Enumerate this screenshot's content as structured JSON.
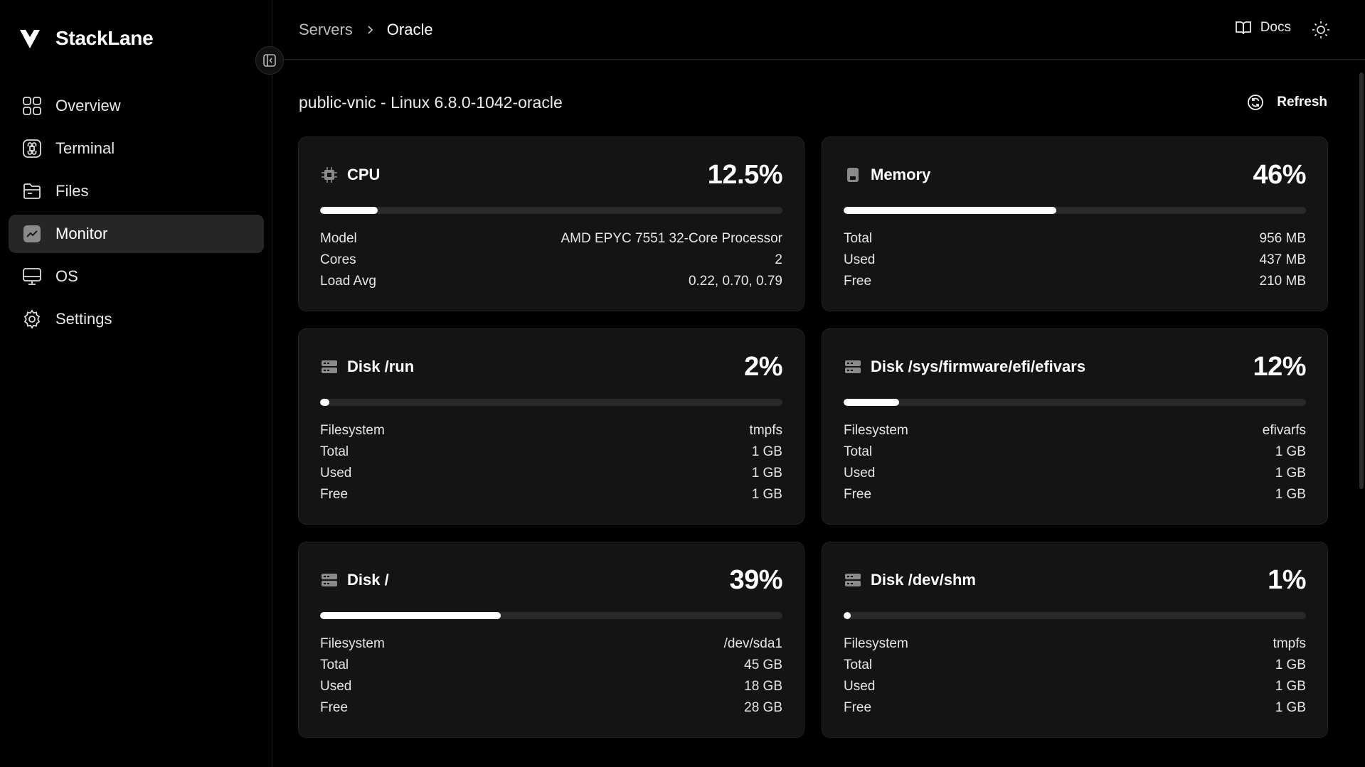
{
  "brand": {
    "name": "StackLane"
  },
  "sidebar": {
    "items": [
      {
        "label": "Overview",
        "icon": "grid-icon"
      },
      {
        "label": "Terminal",
        "icon": "command-icon"
      },
      {
        "label": "Files",
        "icon": "folder-icon"
      },
      {
        "label": "Monitor",
        "icon": "chart-icon",
        "active": true
      },
      {
        "label": "OS",
        "icon": "monitor-icon"
      },
      {
        "label": "Settings",
        "icon": "gear-icon"
      }
    ]
  },
  "header": {
    "breadcrumb": [
      "Servers",
      "Oracle"
    ],
    "docs_label": "Docs"
  },
  "page": {
    "host_title": "public-vnic - Linux 6.8.0-1042-oracle",
    "refresh_label": "Refresh"
  },
  "cards": [
    {
      "title": "CPU",
      "icon": "cpu-icon",
      "percent_label": "12.5%",
      "percent": 12.5,
      "rows": [
        {
          "k": "Model",
          "v": "AMD EPYC 7551 32-Core Processor"
        },
        {
          "k": "Cores",
          "v": "2"
        },
        {
          "k": "Load Avg",
          "v": "0.22, 0.70, 0.79"
        }
      ]
    },
    {
      "title": "Memory",
      "icon": "memory-icon",
      "percent_label": "46%",
      "percent": 46,
      "rows": [
        {
          "k": "Total",
          "v": "956 MB"
        },
        {
          "k": "Used",
          "v": "437 MB"
        },
        {
          "k": "Free",
          "v": "210 MB"
        }
      ]
    },
    {
      "title": "Disk /run",
      "icon": "disk-icon",
      "percent_label": "2%",
      "percent": 2,
      "rows": [
        {
          "k": "Filesystem",
          "v": "tmpfs"
        },
        {
          "k": "Total",
          "v": "1 GB"
        },
        {
          "k": "Used",
          "v": "1 GB"
        },
        {
          "k": "Free",
          "v": "1 GB"
        }
      ]
    },
    {
      "title": "Disk /sys/firmware/efi/efivars",
      "icon": "disk-icon",
      "percent_label": "12%",
      "percent": 12,
      "rows": [
        {
          "k": "Filesystem",
          "v": "efivarfs"
        },
        {
          "k": "Total",
          "v": "1 GB"
        },
        {
          "k": "Used",
          "v": "1 GB"
        },
        {
          "k": "Free",
          "v": "1 GB"
        }
      ]
    },
    {
      "title": "Disk /",
      "icon": "disk-icon",
      "percent_label": "39%",
      "percent": 39,
      "rows": [
        {
          "k": "Filesystem",
          "v": "/dev/sda1"
        },
        {
          "k": "Total",
          "v": "45 GB"
        },
        {
          "k": "Used",
          "v": "18 GB"
        },
        {
          "k": "Free",
          "v": "28 GB"
        }
      ]
    },
    {
      "title": "Disk /dev/shm",
      "icon": "disk-icon",
      "percent_label": "1%",
      "percent": 1,
      "rows": [
        {
          "k": "Filesystem",
          "v": "tmpfs"
        },
        {
          "k": "Total",
          "v": "1 GB"
        },
        {
          "k": "Used",
          "v": "1 GB"
        },
        {
          "k": "Free",
          "v": "1 GB"
        }
      ]
    }
  ]
}
